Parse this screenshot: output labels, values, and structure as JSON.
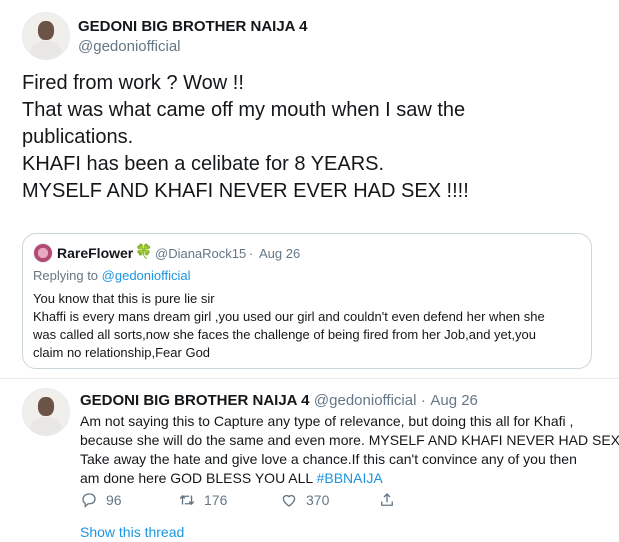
{
  "main_tweet": {
    "author_name": "GEDONI BIG BROTHER NAIJA 4",
    "author_handle": "@gedoniofficial",
    "text": "Fired from work ? Wow !!\nThat was what came off my mouth when I saw the\npublications.\nKHAFI has been a celibate for 8 YEARS.\nMYSELF AND KHAFI NEVER EVER HAD SEX !!!!"
  },
  "quoted_tweet": {
    "author_name": "RareFlower",
    "author_emoji": "🍀",
    "author_handle": "@DianaRock15",
    "separator": "·",
    "date": "Aug 26",
    "replying_prefix": "Replying to",
    "replying_handle": "@gedoniofficial",
    "text": "You know that this is pure lie sir\nKhaffi is every mans dream girl ,you used our girl and couldn't even defend her when she\nwas called all sorts,now she faces the challenge of being fired from her Job,and yet,you\nclaim no relationship,Fear God"
  },
  "reply_tweet": {
    "author_name": "GEDONI BIG BROTHER NAIJA 4",
    "author_handle": "@gedoniofficial",
    "separator": "·",
    "date": "Aug 26",
    "text_line1": "Am not saying this to Capture any type of relevance, but doing this all for Khafi ,",
    "text_line2": "because she will do the same and even more. MYSELF AND KHAFI NEVER HAD SEX,",
    "text_line3": "Take away the hate and give love a chance.If this can't convince any of you then",
    "text_line4_plain": "am done here GOD BLESS YOU ALL ",
    "hashtag": "#BBNAIJA",
    "replies_count": "96",
    "retweets_count": "176",
    "likes_count": "370"
  },
  "show_thread_label": "Show this thread",
  "colors": {
    "link": "#1b95e0",
    "secondary_text": "#657786",
    "border": "#ccd6dd"
  }
}
